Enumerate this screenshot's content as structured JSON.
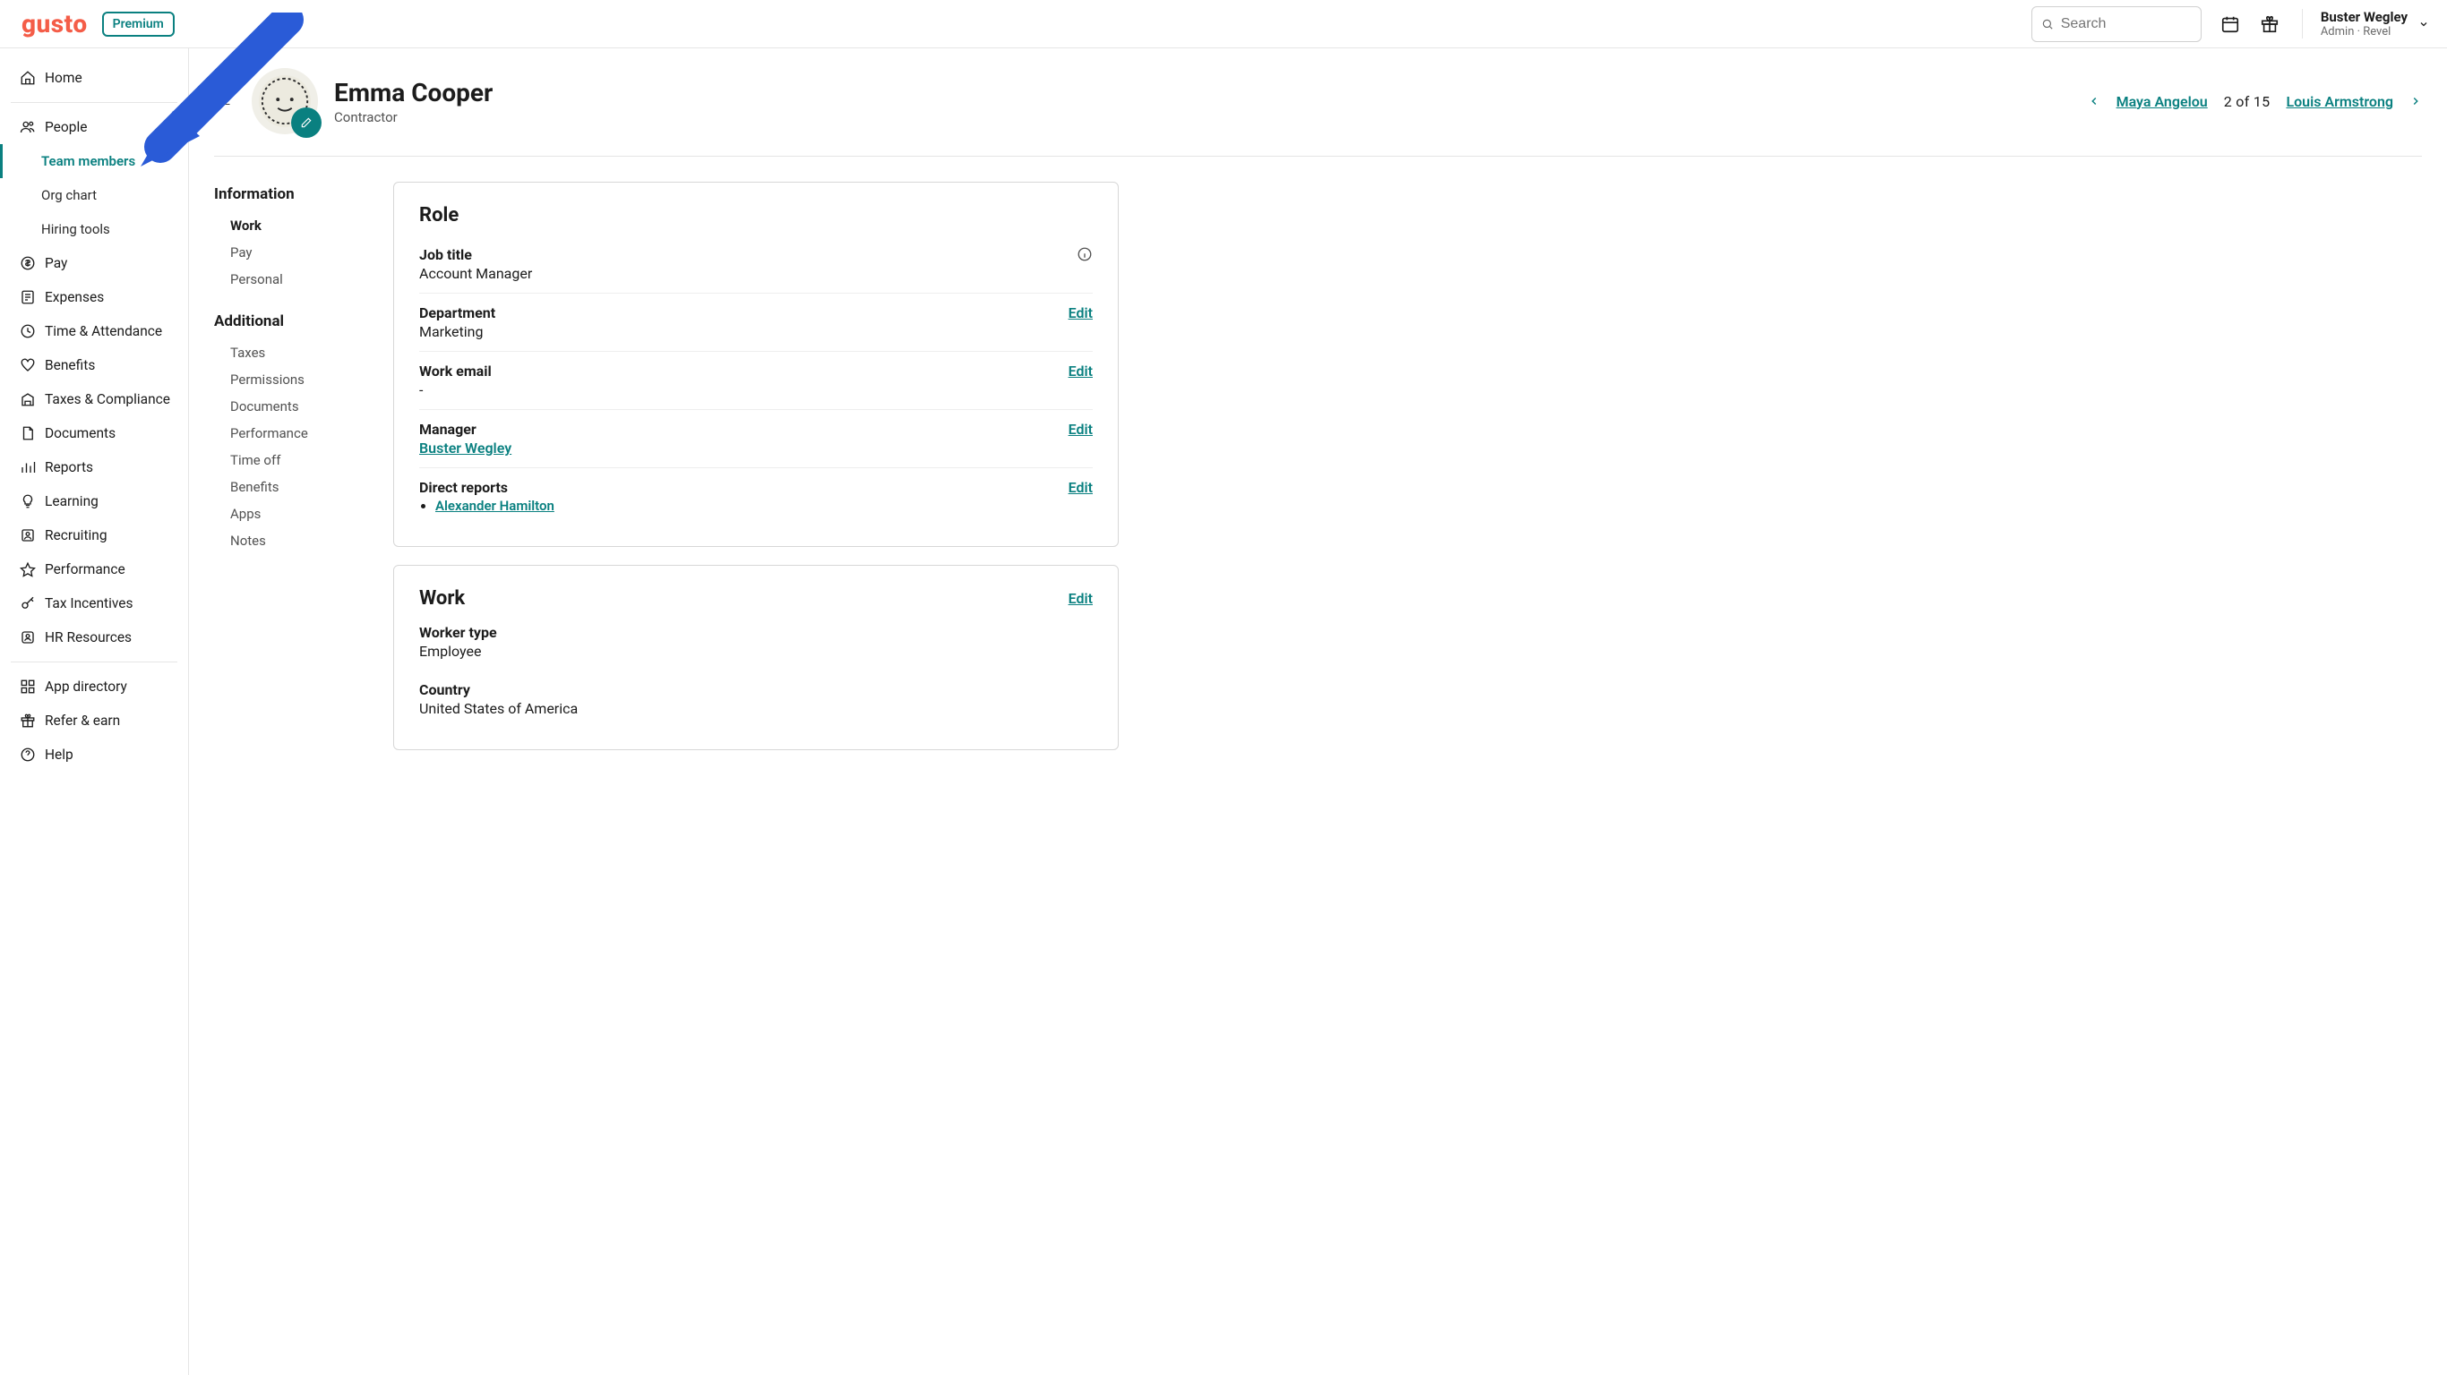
{
  "header": {
    "logo": "gusto",
    "premium": "Premium",
    "search_placeholder": "Search",
    "user_name": "Buster Wegley",
    "user_role": "Admin · Revel"
  },
  "sidebar": {
    "home": "Home",
    "people": "People",
    "team_members": "Team members",
    "org_chart": "Org chart",
    "hiring_tools": "Hiring tools",
    "pay": "Pay",
    "expenses": "Expenses",
    "time_attendance": "Time & Attendance",
    "benefits": "Benefits",
    "taxes_compliance": "Taxes & Compliance",
    "documents": "Documents",
    "reports": "Reports",
    "learning": "Learning",
    "recruiting": "Recruiting",
    "performance": "Performance",
    "tax_incentives": "Tax Incentives",
    "hr_resources": "HR Resources",
    "app_directory": "App directory",
    "refer_earn": "Refer & earn",
    "help": "Help"
  },
  "profile": {
    "name": "Emma Cooper",
    "subtitle": "Contractor",
    "pager_prev": "Maya Angelou",
    "pager_pos": "2 of 15",
    "pager_next": "Louis Armstrong"
  },
  "mini_nav": {
    "information": "Information",
    "work": "Work",
    "pay": "Pay",
    "personal": "Personal",
    "additional": "Additional",
    "taxes": "Taxes",
    "permissions": "Permissions",
    "documents": "Documents",
    "performance": "Performance",
    "time_off": "Time off",
    "benefits": "Benefits",
    "apps": "Apps",
    "notes": "Notes"
  },
  "role_card": {
    "title": "Role",
    "job_title_label": "Job title",
    "job_title_value": "Account Manager",
    "department_label": "Department",
    "department_value": "Marketing",
    "department_edit": "Edit",
    "work_email_label": "Work email",
    "work_email_value": "-",
    "work_email_edit": "Edit",
    "manager_label": "Manager",
    "manager_value": "Buster Wegley",
    "manager_edit": "Edit",
    "direct_reports_label": "Direct reports",
    "direct_reports_0": "Alexander Hamilton",
    "direct_reports_edit": "Edit"
  },
  "work_card": {
    "title": "Work",
    "edit": "Edit",
    "worker_type_label": "Worker type",
    "worker_type_value": "Employee",
    "country_label": "Country",
    "country_value": "United States of America"
  }
}
